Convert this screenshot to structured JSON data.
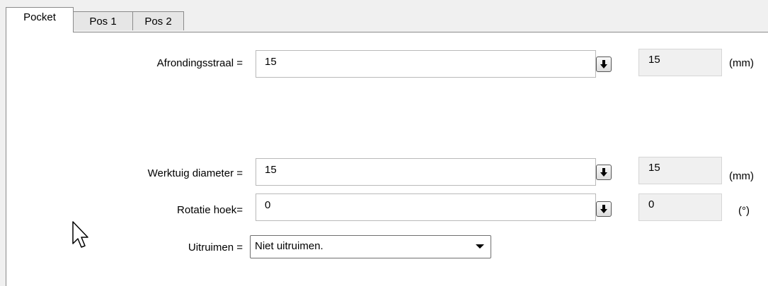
{
  "tabs": [
    {
      "label": "Pocket",
      "active": true
    },
    {
      "label": "Pos 1",
      "active": false
    },
    {
      "label": "Pos 2",
      "active": false
    }
  ],
  "fields": {
    "afrondingsstraal": {
      "label": "Afrondingsstraal =",
      "value": "15",
      "readout": "15",
      "unit": "(mm)"
    },
    "werktuig_diameter": {
      "label": "Werktuig diameter =",
      "value": "15",
      "readout": "15",
      "unit": "(mm)"
    },
    "rotatie_hoek": {
      "label": "Rotatie hoek=",
      "value": "0",
      "readout": "0",
      "unit": "(°)"
    },
    "uitruimen": {
      "label": "Uitruimen =",
      "selected": "Niet uitruimen."
    }
  },
  "icons": {
    "apply": "arrow-down-icon",
    "dropdown": "chevron-down-icon",
    "cursor": "mouse-pointer-icon"
  }
}
